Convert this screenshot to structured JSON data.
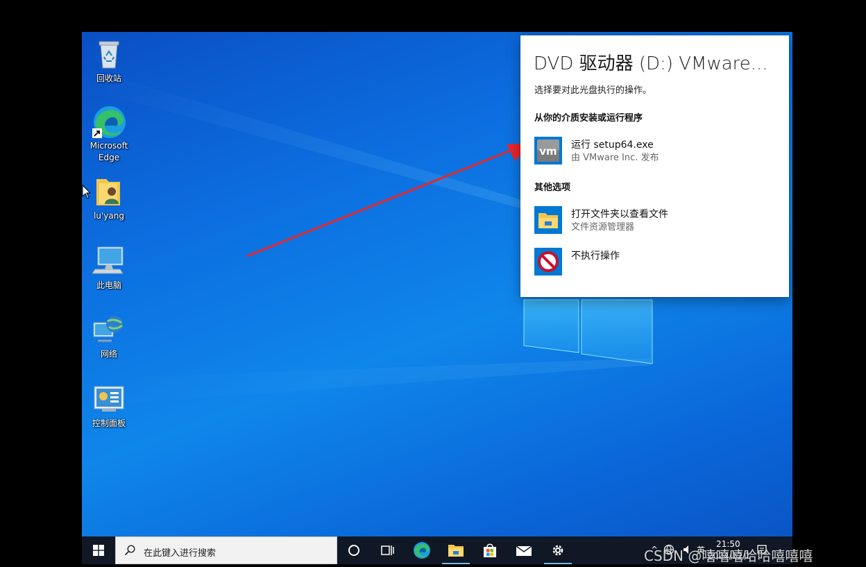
{
  "desktop": {
    "icons": [
      {
        "label": "回收站",
        "icon": "recycle-bin-icon"
      },
      {
        "label": "Microsoft Edge",
        "icon": "edge-icon"
      },
      {
        "label": "lu'yang",
        "icon": "user-folder-icon"
      },
      {
        "label": "此电脑",
        "icon": "computer-icon"
      },
      {
        "label": "网络",
        "icon": "network-icon"
      },
      {
        "label": "控制面板",
        "icon": "control-panel-icon"
      }
    ],
    "edge_label_line1": "Microsoft",
    "edge_label_line2": "Edge"
  },
  "autoplay": {
    "title": "DVD 驱动器 (D:) VMware...",
    "subtitle": "选择要对此光盘执行的操作。",
    "section_install": "从你的介质安装或运行程序",
    "option_run": {
      "label": "运行 setup64.exe",
      "sub": "由 VMware Inc. 发布",
      "icon": "vmware-icon"
    },
    "section_other": "其他选项",
    "option_open_folder": {
      "label": "打开文件夹以查看文件",
      "sub": "文件资源管理器",
      "icon": "folder-icon"
    },
    "option_none": {
      "label": "不执行操作",
      "icon": "no-action-icon"
    }
  },
  "taskbar": {
    "search_placeholder": "在此键入进行搜索",
    "apps": [
      "cortana-icon",
      "task-view-icon",
      "edge-icon",
      "file-explorer-icon",
      "store-icon",
      "mail-icon",
      "settings-icon"
    ],
    "tray": {
      "chevron": "^",
      "ime": "英",
      "time": "21:50",
      "date": "2024/12/1"
    }
  },
  "watermark": "CSDN @嘻嘻嘻哈哈嘻嘻嘻",
  "colors": {
    "accent": "#0078d4",
    "arrow": "#e8262b",
    "taskbar": "#101826"
  }
}
